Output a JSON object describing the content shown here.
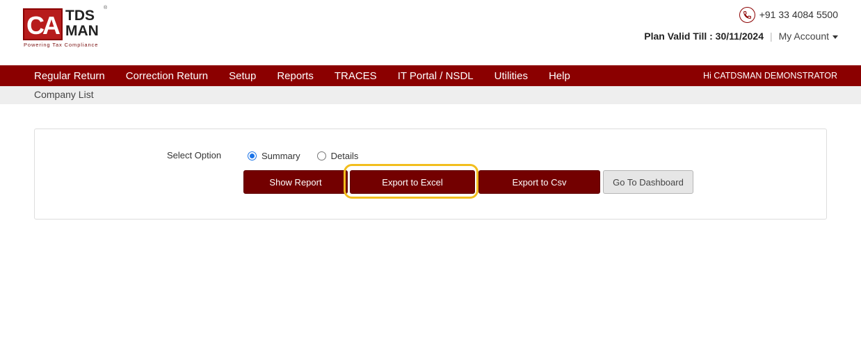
{
  "logo": {
    "mark": "CA",
    "line1": "TDS",
    "line2": "MAN",
    "registered": "®",
    "tagline": "Powering Tax Compliance"
  },
  "header": {
    "phone": "+91 33 4084 5500",
    "plan_valid": "Plan Valid Till : 30/11/2024",
    "separator": "|",
    "my_account": "My Account"
  },
  "nav": {
    "items": [
      {
        "label": "Regular Return"
      },
      {
        "label": "Correction Return"
      },
      {
        "label": "Setup"
      },
      {
        "label": "Reports"
      },
      {
        "label": "TRACES"
      },
      {
        "label": "IT Portal / NSDL"
      },
      {
        "label": "Utilities"
      },
      {
        "label": "Help"
      }
    ],
    "greeting": "Hi CATDSMAN DEMONSTRATOR"
  },
  "breadcrumb": "Company List",
  "form": {
    "select_label": "Select Option",
    "options": [
      {
        "label": "Summary",
        "checked": true
      },
      {
        "label": "Details",
        "checked": false
      }
    ],
    "buttons": {
      "show_report": "Show Report",
      "export_excel": "Export to Excel",
      "export_csv": "Export to Csv",
      "go_dashboard": "Go To Dashboard"
    }
  },
  "colors": {
    "brand": "#8b0000",
    "button": "#730000",
    "highlight": "#f2be1d",
    "radio": "#1a73e8"
  },
  "icons": {
    "phone": "phone-icon",
    "dropdown": "caret-down-icon"
  }
}
